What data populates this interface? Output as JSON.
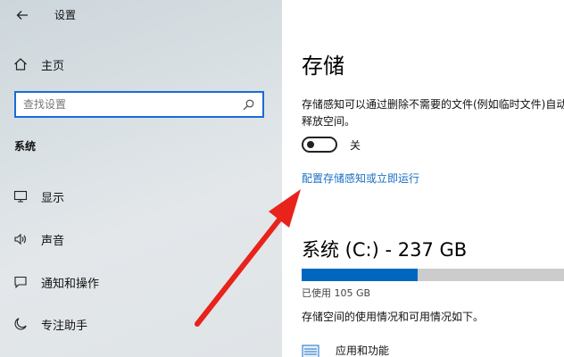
{
  "window": {
    "title": "设置"
  },
  "sidebar": {
    "home_label": "主页",
    "search_placeholder": "查找设置",
    "section_header": "系统",
    "items": [
      {
        "label": "显示",
        "icon": "monitor-icon"
      },
      {
        "label": "声音",
        "icon": "speaker-icon"
      },
      {
        "label": "通知和操作",
        "icon": "notification-icon"
      },
      {
        "label": "专注助手",
        "icon": "moon-icon"
      }
    ]
  },
  "main": {
    "title": "存储",
    "description": "存储感知可以通过删除不需要的文件(例如临时文件)自动释放空间。",
    "storage_sense": {
      "state": "关",
      "on": false
    },
    "config_link": "配置存储感知或立即运行",
    "drive": {
      "title": "系统 (C:) - 237 GB",
      "used_label": "已使用 105 GB",
      "used_fraction": 0.443
    },
    "storage_usage_desc": "存储空间的使用情况和可用情况如下。",
    "categories": [
      {
        "label": "应用和功能",
        "icon": "apps-icon"
      }
    ]
  },
  "colors": {
    "accent": "#1a6bd6",
    "link": "#1a6fc4",
    "bar_fill": "#0067c0",
    "bar_track": "#cccccc",
    "annotation_arrow": "#e8231b"
  }
}
